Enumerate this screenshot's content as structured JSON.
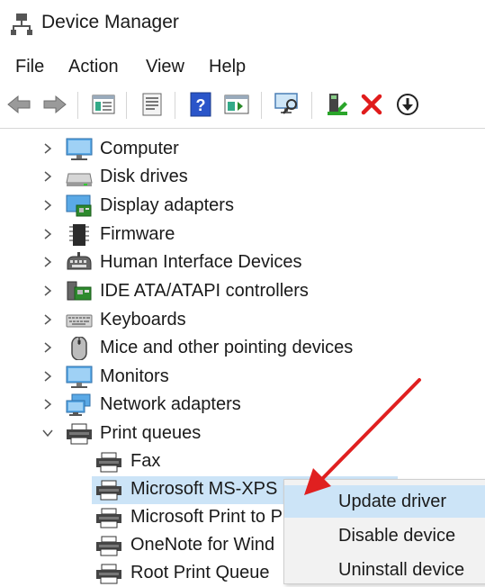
{
  "window": {
    "title": "Device Manager"
  },
  "menu": [
    "File",
    "Action",
    "View",
    "Help"
  ],
  "toolbar": {
    "buttons": [
      "back-icon",
      "forward-icon",
      "properties-grid-icon",
      "properties-sheet-icon",
      "help-icon",
      "update-driver-icon",
      "scan-hardware-icon",
      "enable-device-icon",
      "uninstall-icon",
      "download-icon"
    ]
  },
  "tree": {
    "categories": [
      {
        "label": "Computer",
        "icon": "computer-icon",
        "expanded": false
      },
      {
        "label": "Disk drives",
        "icon": "disk-drive-icon",
        "expanded": false
      },
      {
        "label": "Display adapters",
        "icon": "display-adapter-icon",
        "expanded": false
      },
      {
        "label": "Firmware",
        "icon": "firmware-icon",
        "expanded": false
      },
      {
        "label": "Human Interface Devices",
        "icon": "hid-icon",
        "expanded": false
      },
      {
        "label": "IDE ATA/ATAPI controllers",
        "icon": "ide-controller-icon",
        "expanded": false
      },
      {
        "label": "Keyboards",
        "icon": "keyboard-icon",
        "expanded": false
      },
      {
        "label": "Mice and other pointing devices",
        "icon": "mouse-icon",
        "expanded": false
      },
      {
        "label": "Monitors",
        "icon": "monitor-icon",
        "expanded": false
      },
      {
        "label": "Network adapters",
        "icon": "network-adapter-icon",
        "expanded": false
      },
      {
        "label": "Print queues",
        "icon": "printer-icon",
        "expanded": true
      }
    ],
    "print_queues": [
      {
        "label": "Fax",
        "selected": false
      },
      {
        "label": "Microsoft MS-XPS",
        "selected": true
      },
      {
        "label": "Microsoft Print to P",
        "selected": false
      },
      {
        "label": "OneNote for Wind",
        "selected": false
      },
      {
        "label": "Root Print Queue",
        "selected": false
      }
    ]
  },
  "context_menu": {
    "items": [
      {
        "label": "Update driver",
        "highlighted": true
      },
      {
        "label": "Disable device",
        "highlighted": false
      },
      {
        "label": "Uninstall device",
        "highlighted": false
      }
    ]
  },
  "colors": {
    "selection": "#cce4f7",
    "annotation_arrow": "#e02020"
  }
}
